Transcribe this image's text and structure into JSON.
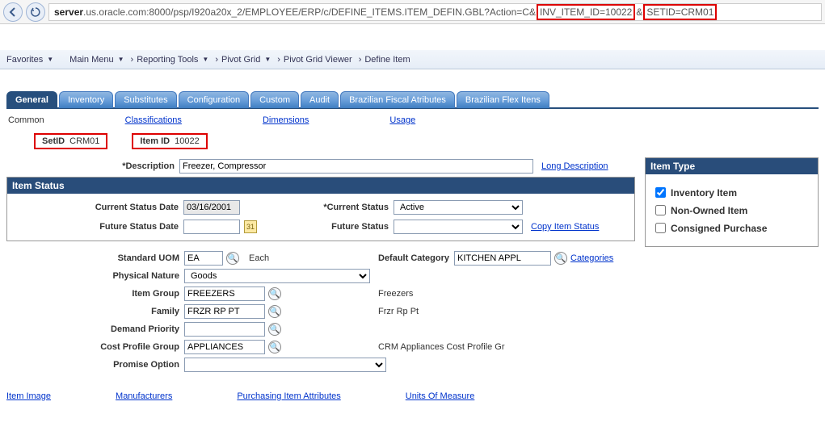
{
  "url": {
    "p1": "server",
    "p2": ".us.oracle.com:8000/psp/I920a20x_2/EMPLOYEE/ERP/c/DEFINE_ITEMS.ITEM_DEFIN.GBL?Action=C&",
    "h1": "INV_ITEM_ID=10022",
    "p3": "&",
    "h2": "SETID=CRM01"
  },
  "crumbs": {
    "c0": "Favorites",
    "c1": "Main Menu",
    "c2": "Reporting Tools",
    "c3": "Pivot Grid",
    "c4": "Pivot Grid Viewer",
    "c5": "Define Item"
  },
  "tabs": {
    "t0": "General",
    "t1": "Inventory",
    "t2": "Substitutes",
    "t3": "Configuration",
    "t4": "Custom",
    "t5": "Audit",
    "t6": "Brazilian Fiscal Atributes",
    "t7": "Brazilian Flex Itens"
  },
  "sublinks": {
    "common": "Common",
    "classifications": "Classifications",
    "dimensions": "Dimensions",
    "usage": "Usage"
  },
  "ids": {
    "setid_lbl": "SetID",
    "setid_val": "CRM01",
    "itemid_lbl": "Item ID",
    "itemid_val": "10022"
  },
  "desc": {
    "lbl": "Description",
    "val": "Freezer, Compressor",
    "long_link": "Long Description"
  },
  "item_status": {
    "title": "Item Status",
    "csd_lbl": "Current Status Date",
    "csd_val": "03/16/2001",
    "cs_lbl": "Current Status",
    "cs_val": "Active",
    "fsd_lbl": "Future Status Date",
    "fsd_val": "",
    "fs_lbl": "Future Status",
    "fs_val": "",
    "copy_link": "Copy Item Status"
  },
  "item_type": {
    "title": "Item Type",
    "inv": "Inventory Item",
    "non": "Non-Owned Item",
    "con": "Consigned Purchase"
  },
  "mid": {
    "uom_lbl": "Standard UOM",
    "uom_val": "EA",
    "uom_desc": "Each",
    "cat_lbl": "Default Category",
    "cat_val": "KITCHEN APPL",
    "cat_link": "Categories",
    "phys_lbl": "Physical Nature",
    "phys_val": "Goods",
    "grp_lbl": "Item Group",
    "grp_val": "FREEZERS",
    "grp_desc": "Freezers",
    "fam_lbl": "Family",
    "fam_val": "FRZR RP PT",
    "fam_desc": "Frzr Rp Pt",
    "dp_lbl": "Demand Priority",
    "dp_val": "",
    "cpg_lbl": "Cost Profile Group",
    "cpg_val": "APPLIANCES",
    "cpg_desc": "CRM Appliances Cost Profile Gr",
    "po_lbl": "Promise Option",
    "po_val": ""
  },
  "bottom": {
    "img": "Item Image",
    "man": "Manufacturers",
    "pia": "Purchasing Item Attributes",
    "uom": "Units Of Measure"
  }
}
